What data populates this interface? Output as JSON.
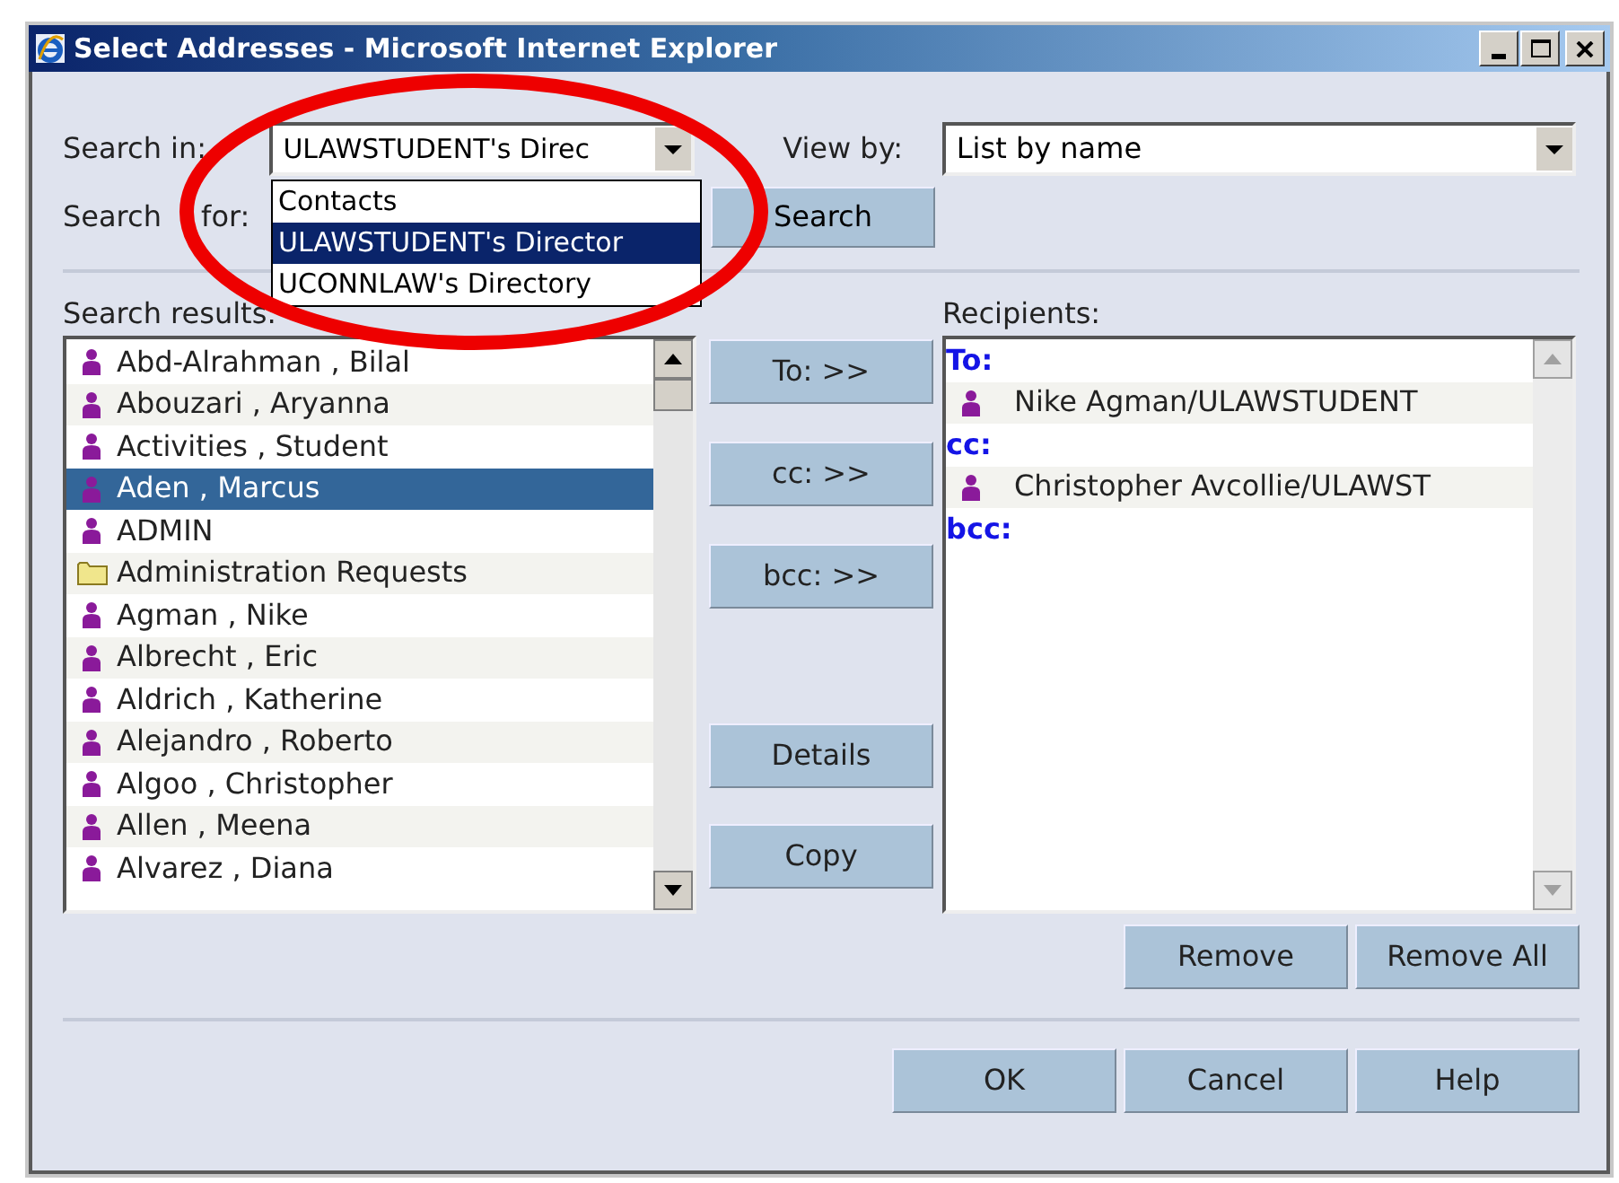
{
  "window": {
    "title": "Select Addresses - Microsoft Internet Explorer"
  },
  "search_in": {
    "label": "Search in:",
    "value": "ULAWSTUDENT's Direc",
    "expanded": true,
    "options": [
      {
        "label": "Contacts",
        "selected": false
      },
      {
        "label": "ULAWSTUDENT's Director",
        "selected": true
      },
      {
        "label": "UCONNLAW's Directory",
        "selected": false
      }
    ]
  },
  "view_by": {
    "label": "View by:",
    "value": "List by name"
  },
  "search_for": {
    "label": "Search for:"
  },
  "search_button": "Search",
  "results": {
    "label": "Search results:",
    "items": [
      {
        "name": "Abd-Alrahman , Bilal",
        "kind": "person",
        "selected": false
      },
      {
        "name": "Abouzari , Aryanna",
        "kind": "person",
        "selected": false
      },
      {
        "name": "Activities , Student",
        "kind": "person",
        "selected": false
      },
      {
        "name": "Aden , Marcus",
        "kind": "person",
        "selected": true
      },
      {
        "name": "ADMIN",
        "kind": "person",
        "selected": false
      },
      {
        "name": "Administration Requests",
        "kind": "folder",
        "selected": false
      },
      {
        "name": "Agman , Nike",
        "kind": "person",
        "selected": false
      },
      {
        "name": "Albrecht , Eric",
        "kind": "person",
        "selected": false
      },
      {
        "name": "Aldrich , Katherine",
        "kind": "person",
        "selected": false
      },
      {
        "name": "Alejandro , Roberto",
        "kind": "person",
        "selected": false
      },
      {
        "name": "Algoo , Christopher",
        "kind": "person",
        "selected": false
      },
      {
        "name": "Allen , Meena",
        "kind": "person",
        "selected": false
      },
      {
        "name": "Alvarez , Diana",
        "kind": "person",
        "selected": false
      }
    ]
  },
  "add_buttons": [
    "To: >>",
    "cc: >>",
    "bcc: >>"
  ],
  "action_buttons": [
    "Details",
    "Copy"
  ],
  "recipients": {
    "label": "Recipients:",
    "groups": [
      {
        "heading": "To:",
        "entries": [
          "Nike Agman/ULAWSTUDENT"
        ]
      },
      {
        "heading": "cc:",
        "entries": [
          "Christopher Avcollie/ULAWST"
        ]
      },
      {
        "heading": "bcc:"
      }
    ]
  },
  "remove_buttons": [
    "Remove",
    "Remove All"
  ],
  "dialog_buttons": [
    "OK",
    "Cancel",
    "Help"
  ],
  "annotation": {
    "kind": "ellipse"
  }
}
